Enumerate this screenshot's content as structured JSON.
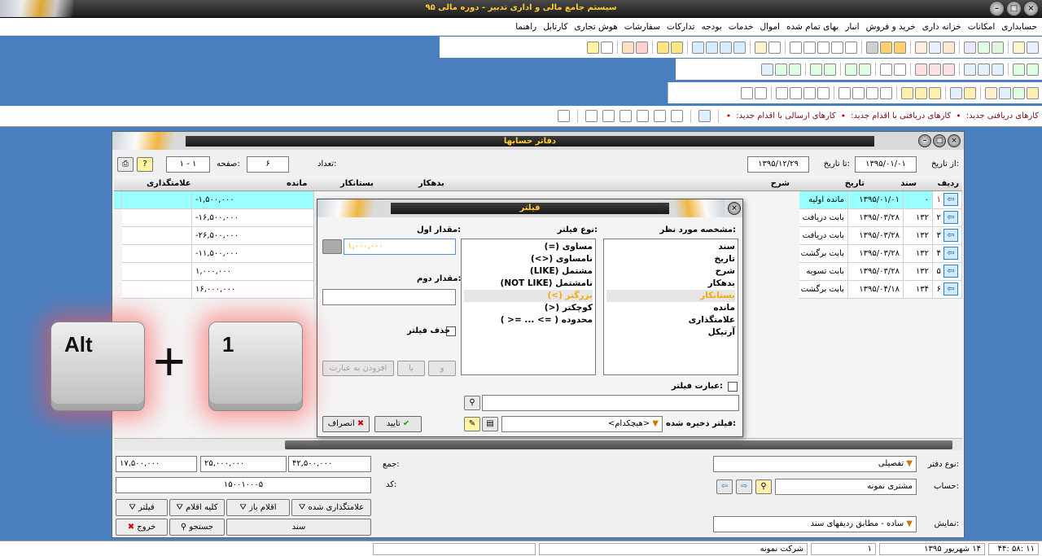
{
  "app_title": "سیستم جامع مالی و اداری تدبیر - دوره مالی ۹۵",
  "menu": [
    "حسابداری",
    "امکانات",
    "خزانه داری",
    "خرید و فروش",
    "انبار",
    "بهای تمام شده",
    "اموال",
    "خدمات",
    "بودجه",
    "تدارکات",
    "سفارشات",
    "هوش تجاری",
    "کارتابل",
    "راهنما"
  ],
  "notifications": {
    "received": "کارهای دریافتی جدید:",
    "received_action": "کارهای دریافتی با اقدام جدید:",
    "sent_action": "کارهای ارسالی با اقدام جدید:",
    "dot": "•"
  },
  "ledger": {
    "title": "دفاتر حسابها",
    "from_date_label": "از تاریخ:",
    "from_date": "۱۳۹۵/۰۱/۰۱",
    "to_date_label": "تا تاریخ:",
    "to_date": "۱۳۹۵/۱۲/۲۹",
    "count_label": "تعداد:",
    "count": "۶",
    "page_label": "صفحه:",
    "page": "۱ - ۱",
    "columns": {
      "row": "ردیف",
      "doc": "سند",
      "date": "تاریخ",
      "desc": "شرح",
      "debit": "بدهکار",
      "credit": "بستانکار",
      "balance": "مانده",
      "mark": "علامتگذاری"
    },
    "rows": [
      {
        "row": "۱",
        "doc": "۰",
        "date": "۱۳۹۵/۰۱/۰۱",
        "desc": "مانده اولیه",
        "balance": "-۱,۵۰۰,۰۰۰"
      },
      {
        "row": "۲",
        "doc": "۱۳۲",
        "date": "۱۳۹۵/۰۳/۲۸",
        "desc": "بابت دریافت",
        "balance": "-۱۶,۵۰۰,۰۰۰"
      },
      {
        "row": "۳",
        "doc": "۱۳۲",
        "date": "۱۳۹۵/۰۳/۲۸",
        "desc": "بابت دریافت",
        "balance": "-۲۶,۵۰۰,۰۰۰"
      },
      {
        "row": "۴",
        "doc": "۱۳۲",
        "date": "۱۳۹۵/۰۳/۲۸",
        "desc": "بابت برگشت",
        "balance": "-۱۱,۵۰۰,۰۰۰"
      },
      {
        "row": "۵",
        "doc": "۱۳۲",
        "date": "۱۳۹۵/۰۳/۲۸",
        "desc": "بابت تسویه",
        "balance": "۱,۰۰۰,۰۰۰"
      },
      {
        "row": "۶",
        "doc": "۱۳۴",
        "date": "۱۳۹۵/۰۴/۱۸",
        "desc": "بابت برگشت",
        "balance": "۱۶,۰۰۰,۰۰۰"
      }
    ],
    "totals_label": "جمع:",
    "total_debit": "۴۲,۵۰۰,۰۰۰",
    "total_credit": "۲۵,۰۰۰,۰۰۰",
    "total_balance": "۱۷,۵۰۰,۰۰۰",
    "code_label": "کد:",
    "code": "۱۵۰۰۱۰۰۰۵",
    "book_type_label": "نوع دفتر:",
    "book_type": "تفصیلی",
    "account_label": "حساب:",
    "account": "مشتری نمونه",
    "display_label": "نمایش:",
    "display": "ساده - مطابق ردیفهای سند",
    "buttons": {
      "filter": "فیلتر",
      "all_items": "کلیه اقلام",
      "open_items": "اقلام باز",
      "marked": "علامتگذاری شده",
      "exit": "خروج",
      "search": "جستجو",
      "doc": "سند"
    }
  },
  "filter": {
    "title": "فیلتر",
    "field_label": "مشخصه مورد نظر:",
    "fields": [
      "سند",
      "تاریخ",
      "شرح",
      "بدهکار",
      "بستانکار",
      "مانده",
      "علامتگذاری",
      "آرتیکل"
    ],
    "selected_field": "بستانکار",
    "type_label": "نوع فیلتر:",
    "types": [
      "مساوی (=)",
      "نامساوی (<>)",
      "مشتمل (LIKE)",
      "نامشتمل (NOT LIKE)",
      "بزرگتر (>)",
      "کوچکتر (<)",
      "محدوده ( => ... =< )"
    ],
    "selected_type": "بزرگتر (>)",
    "first_value_label": "مقدار اول:",
    "first_value": "۱,۰۰۰,۰۰۰",
    "second_value_label": "مقدار دوم:",
    "second_value": "",
    "delete_filter": "حذف فیلتر",
    "add_btn": "افزودن به عبارت",
    "or_btn": "یا",
    "and_btn": "و",
    "expression_label": "عبارت فیلتر:",
    "saved_label": "فیلتر ذخیره شده:",
    "saved_value": "<هیچکدام>",
    "ok": "تایید",
    "cancel": "انصراف"
  },
  "keys": {
    "first": "Alt",
    "second": "1",
    "plus": "+"
  },
  "status": {
    "time": "۱۱ :۵۸ :۴۴",
    "date": "۱۴ شهریور ۱۳۹۵",
    "num": "۱",
    "company": "شرکت نمونه"
  }
}
